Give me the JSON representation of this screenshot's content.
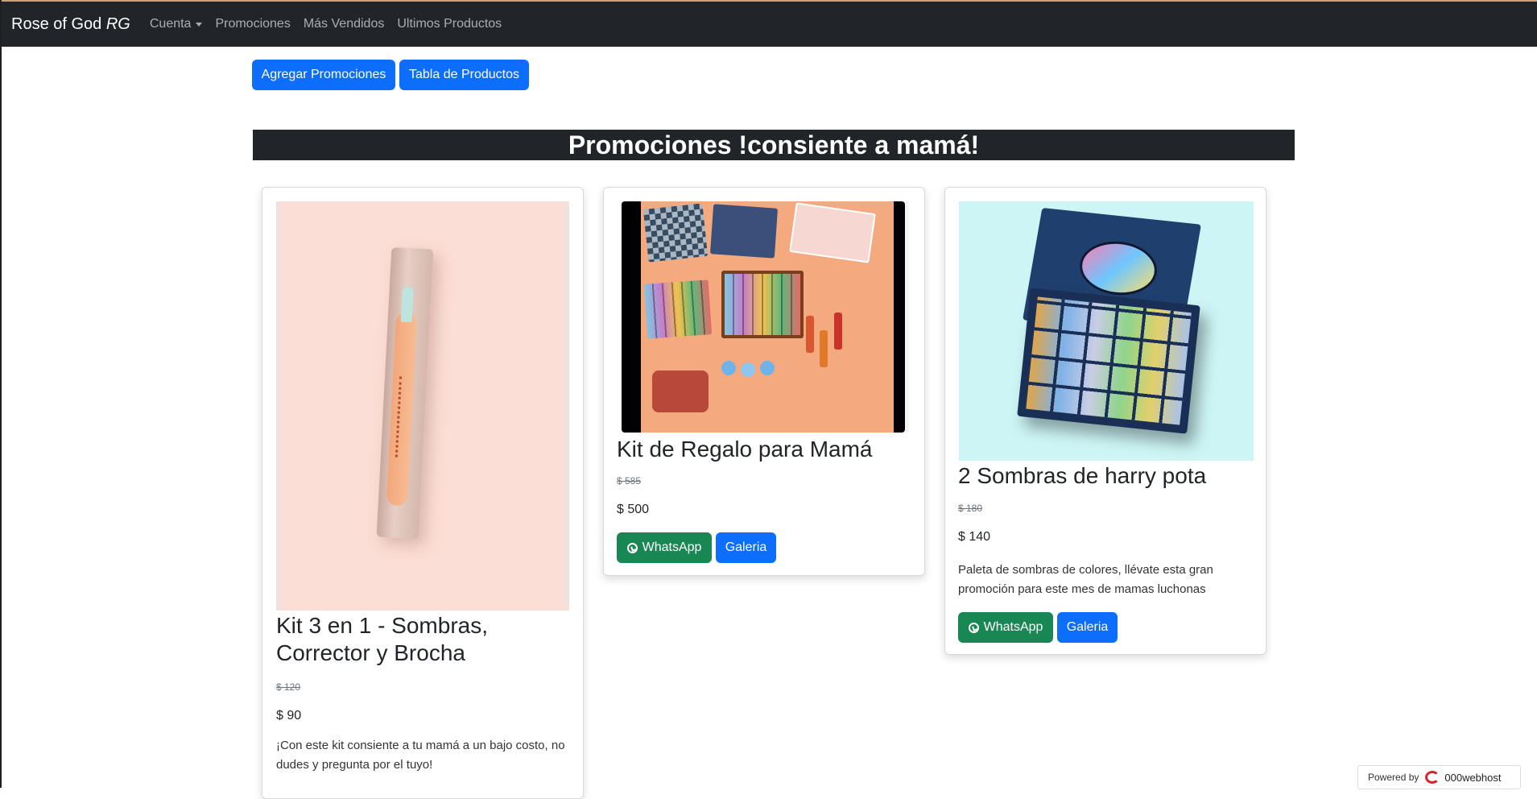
{
  "navbar": {
    "brand_main": "Rose of God",
    "brand_italic": "RG",
    "links": [
      "Cuenta",
      "Promociones",
      "Más Vendidos",
      "Ultimos Productos"
    ]
  },
  "actions": {
    "add_promo": "Agregar Promociones",
    "products_table": "Tabla de Productos"
  },
  "section_title": "Promociones !consiente a mamá!",
  "cards": [
    {
      "title": "Kit 3 en 1 - Sombras, Corrector y Brocha",
      "old_price": "$ 120",
      "price": "$ 90",
      "description": "¡Con este kit consiente a tu mamá a un bajo costo, no dudes y pregunta por el tuyo!"
    },
    {
      "title": "Kit de Regalo para Mamá",
      "old_price": "$ 585",
      "price": "$ 500",
      "whatsapp": "WhatsApp",
      "gallery": "Galeria"
    },
    {
      "title": "2 Sombras de harry pota",
      "old_price": "$ 180",
      "price": "$ 140",
      "description": "Paleta de sombras de colores, llévate esta gran promoción para este mes de mamas luchonas",
      "whatsapp": "WhatsApp",
      "gallery": "Galeria"
    }
  ],
  "footer": {
    "powered_by": "Powered by",
    "host": "000webhost"
  },
  "colors": {
    "navbar": "#212529",
    "primary": "#0d6efd",
    "success": "#198754"
  }
}
